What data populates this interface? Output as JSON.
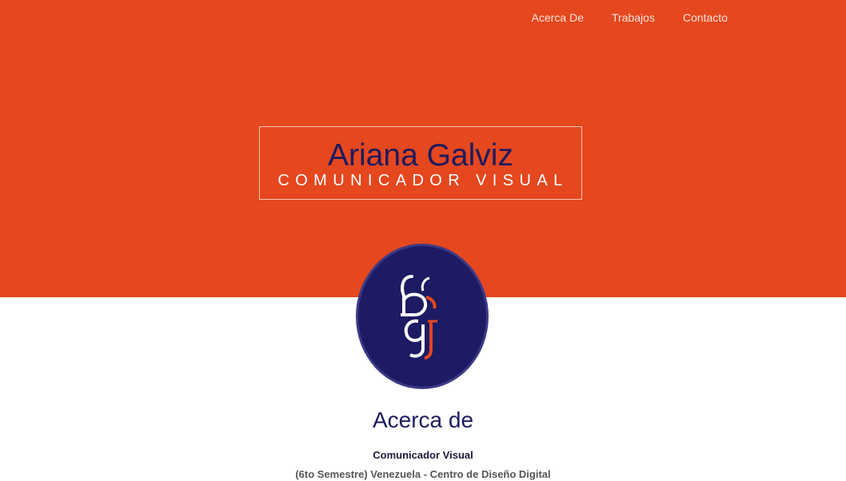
{
  "nav": {
    "items": [
      {
        "label": "Acerca De"
      },
      {
        "label": "Trabajos"
      },
      {
        "label": "Contacto"
      }
    ]
  },
  "hero": {
    "name": "Ariana Galviz",
    "role": "COMUNICADOR VISUAL"
  },
  "logo": {
    "icon": "ag-monogram-icon"
  },
  "about": {
    "heading": "Acerca de",
    "subtitle": "Comunicador Visual",
    "detail": "(6to Semestre) Venezuela - Centro de Diseño Digital"
  },
  "colors": {
    "accent": "#e5471f",
    "navy": "#1d1b63"
  }
}
